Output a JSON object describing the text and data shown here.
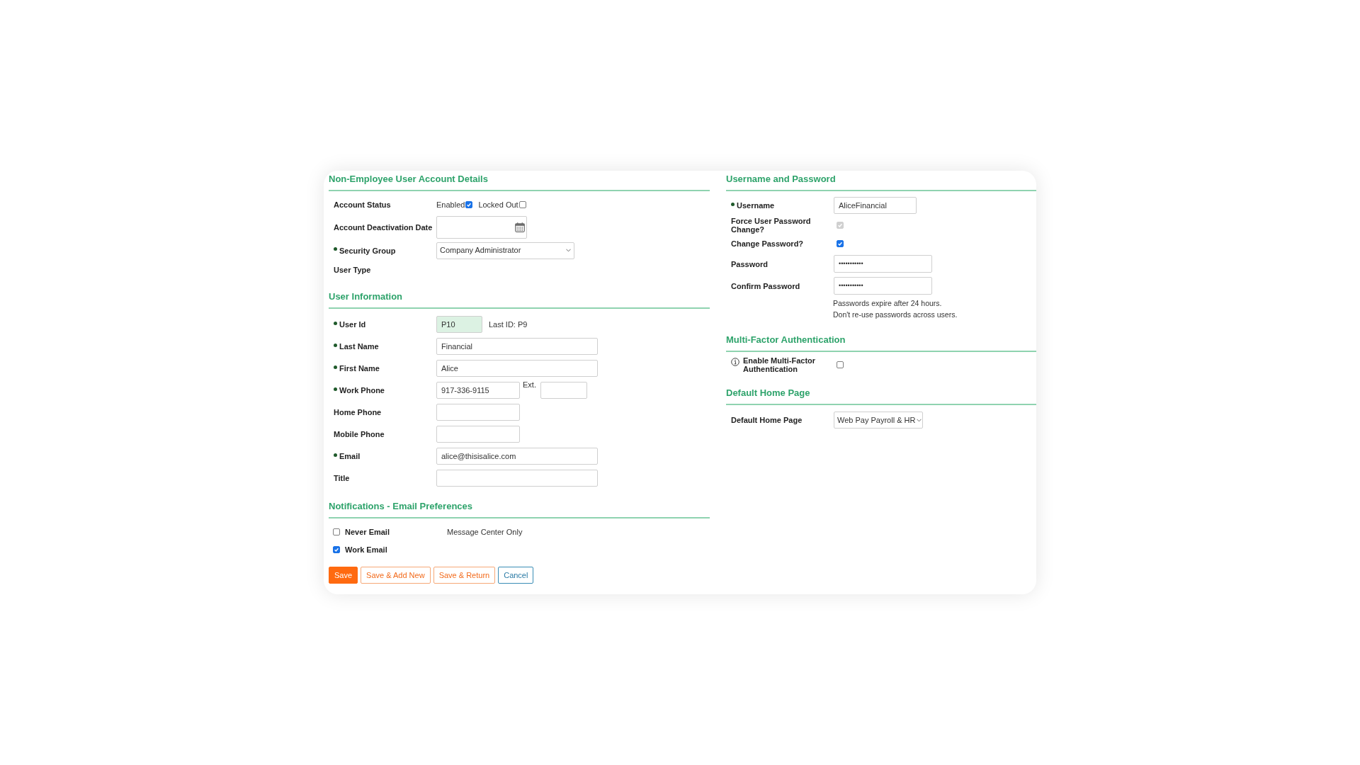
{
  "account_details": {
    "heading": "Non-Employee User Account Details",
    "rows": [
      {
        "kind": "status",
        "label": "Account Status",
        "required": false,
        "options": [
          {
            "label": "Enabled",
            "checked": true
          },
          {
            "label": "Locked Out",
            "checked": false
          }
        ]
      },
      {
        "kind": "date",
        "label": "Account Deactivation Date",
        "required": false
      },
      {
        "kind": "select",
        "label": "Security Group",
        "required": true,
        "value": "Company Administrator"
      },
      {
        "kind": "static",
        "label": "User Type",
        "required": false
      }
    ]
  },
  "user_information": {
    "heading": "User Information",
    "rows": [
      {
        "kind": "id",
        "label": "User Id",
        "required": true,
        "value": "P10",
        "note": "Last ID: P9"
      },
      {
        "kind": "text",
        "label": "Last Name",
        "required": true,
        "value": "Financial"
      },
      {
        "kind": "text",
        "label": "First Name",
        "required": true,
        "value": "Alice"
      },
      {
        "kind": "phone_ext",
        "label": "Work Phone",
        "required": true,
        "value": "917-336-9115",
        "ext_label": "Ext."
      },
      {
        "kind": "phone",
        "label": "Home Phone",
        "required": false
      },
      {
        "kind": "phone",
        "label": "Mobile Phone",
        "required": false
      },
      {
        "kind": "text",
        "label": "Email",
        "required": true,
        "value": "alice@thisisalice.com"
      },
      {
        "kind": "text",
        "label": "Title",
        "required": false
      }
    ]
  },
  "notifications": {
    "heading": "Notifications - Email Preferences",
    "options": [
      {
        "label": "Never Email",
        "checked": false,
        "note": "Message Center Only"
      },
      {
        "label": "Work Email",
        "checked": true
      }
    ]
  },
  "buttons": [
    {
      "label": "Save",
      "kind": "primary"
    },
    {
      "label": "Save & Add New",
      "kind": "secondary"
    },
    {
      "label": "Save & Return",
      "kind": "secondary"
    },
    {
      "label": "Cancel",
      "kind": "cancel"
    }
  ],
  "username_password": {
    "heading": "Username and Password",
    "rows": [
      {
        "kind": "text",
        "label": "Username",
        "required": true,
        "value": "AliceFinancial"
      },
      {
        "kind": "checkbox",
        "label": "Force User Password Change?",
        "required": false,
        "checked": true,
        "disabled": true
      },
      {
        "kind": "checkbox",
        "label": "Change Password?",
        "required": false,
        "checked": true,
        "disabled": false
      },
      {
        "kind": "password",
        "label": "Password",
        "required": false,
        "value": "•••••••••••"
      },
      {
        "kind": "password",
        "label": "Confirm Password",
        "required": false,
        "value": "•••••••••••"
      }
    ],
    "notes": [
      "Passwords expire after 24 hours.",
      "Don't re-use passwords across users."
    ]
  },
  "multi_factor": {
    "heading": "Multi-Factor Authentication",
    "label": "Enable Multi-Factor Authentication",
    "checked": false
  },
  "default_home_page": {
    "heading": "Default Home Page",
    "label": "Default Home Page",
    "value": "Web Pay Payroll & HR"
  }
}
